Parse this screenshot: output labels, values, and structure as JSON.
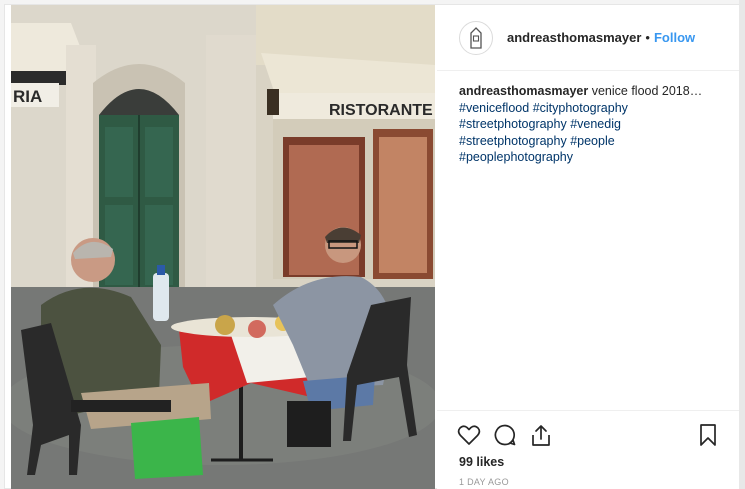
{
  "post": {
    "username": "andreasthomasmayer",
    "separator": "•",
    "follow_label": "Follow",
    "caption": {
      "username": "andreasthomasmayer",
      "text": "venice flood 2018…",
      "hashtags": [
        "#veniceflood",
        "#cityphotography",
        "#streetphotography",
        "#venedig",
        "#streetphotography",
        "#people",
        "#peoplephotography"
      ]
    },
    "likes": "99 likes",
    "time_ago": "1 DAY AGO"
  },
  "photo": {
    "sign_left": "RIA",
    "sign_right": "RISTORANTE"
  },
  "icons": {
    "avatar": "lighthouse-logo-icon",
    "like": "heart-icon",
    "comment": "comment-bubble-icon",
    "share": "share-upload-icon",
    "save": "bookmark-icon"
  },
  "colors": {
    "link_blue": "#3897f0",
    "hashtag": "#003569",
    "meta_grey": "#999999"
  }
}
